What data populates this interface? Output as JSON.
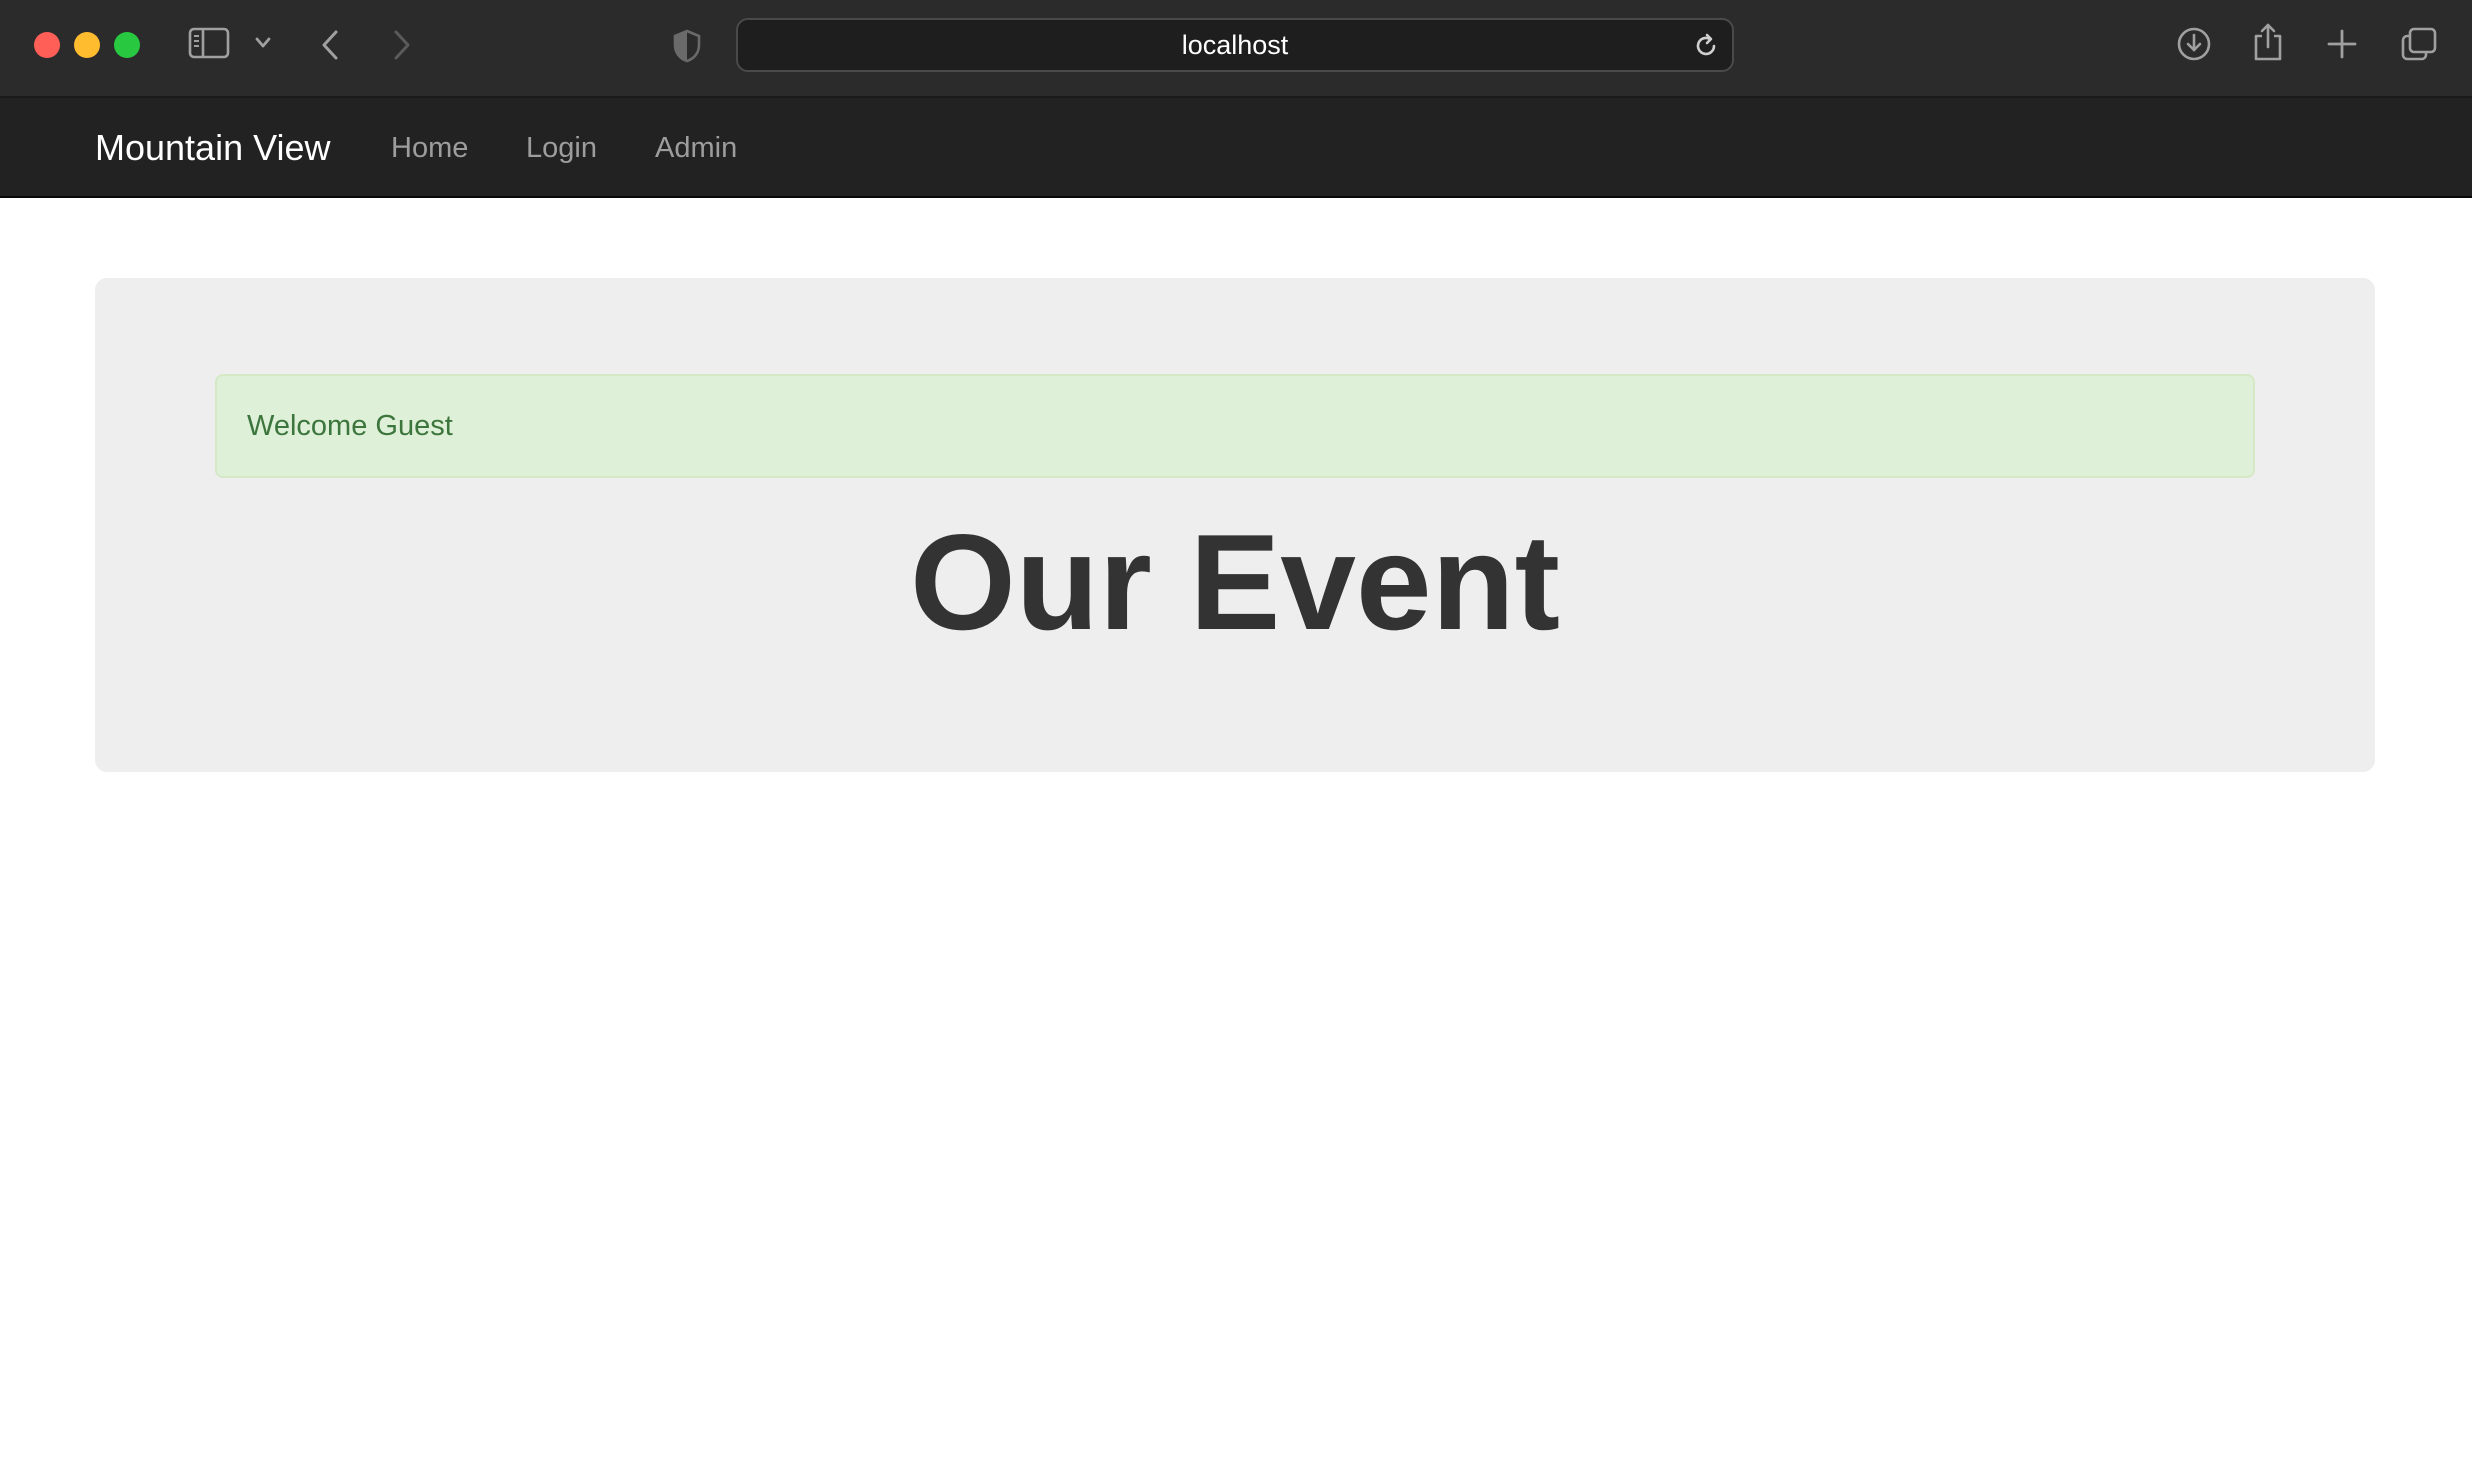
{
  "browser": {
    "address": "localhost"
  },
  "navbar": {
    "brand": "Mountain View",
    "links": [
      {
        "label": "Home"
      },
      {
        "label": "Login"
      },
      {
        "label": "Admin"
      }
    ]
  },
  "main": {
    "alert_text": "Welcome Guest",
    "heading": "Our Event"
  },
  "colors": {
    "chrome_bg": "#2b2b2b",
    "navbar_bg": "#222222",
    "jumbotron_bg": "#eeeeee",
    "alert_bg": "#dff0d8",
    "alert_text": "#3c763d",
    "heading_text": "#333333"
  },
  "icons": {
    "sidebar_toggle": "sidebar-icon",
    "dropdown": "chevron-down-icon",
    "back": "chevron-left-icon",
    "forward": "chevron-right-icon",
    "privacy": "shield-icon",
    "reload": "reload-icon",
    "downloads": "download-icon",
    "share": "share-icon",
    "new_tab": "plus-icon",
    "tabs": "tabs-overview-icon"
  }
}
